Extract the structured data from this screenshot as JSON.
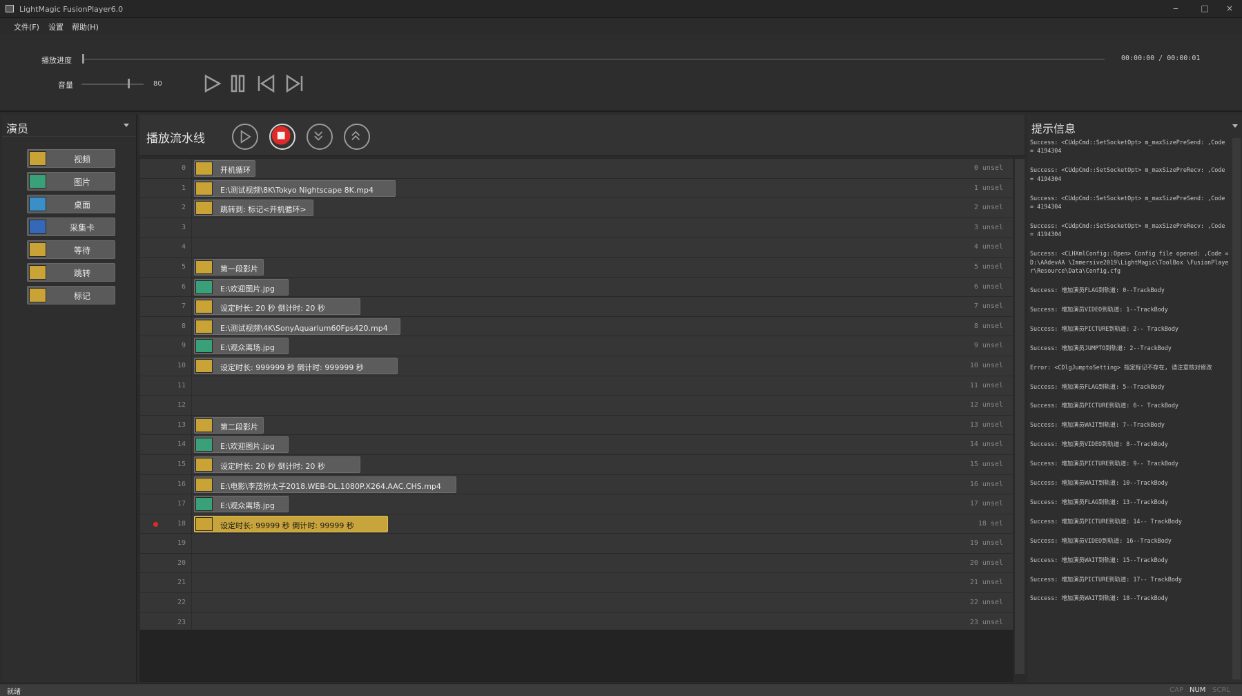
{
  "window": {
    "title": "LightMagic FusionPlayer6.0",
    "controls": [
      "‒",
      "□",
      "×"
    ]
  },
  "menu": [
    "文件(F)",
    "设置",
    "帮助(H)"
  ],
  "transport": {
    "progress_label": "播放进度",
    "time": "00:00:00 / 00:00:01",
    "volume_label": "音量",
    "volume_value": "80",
    "buttons": [
      "play-icon",
      "pause-icon",
      "previous-icon",
      "next-icon"
    ]
  },
  "actors": {
    "title": "演员",
    "items": [
      {
        "label": "视频",
        "icon": "video-icon"
      },
      {
        "label": "图片",
        "icon": "picture-icon"
      },
      {
        "label": "桌面",
        "icon": "desktop-icon"
      },
      {
        "label": "采集卡",
        "icon": "capture-card-icon"
      },
      {
        "label": "等待",
        "icon": "wait-clock-icon"
      },
      {
        "label": "跳转",
        "icon": "jump-icon"
      },
      {
        "label": "标记",
        "icon": "flag-icon"
      }
    ]
  },
  "pipeline": {
    "title": "播放流水线",
    "buttons": [
      "play-icon",
      "stop-icon",
      "collapse-icon",
      "expand-icon"
    ],
    "rows": [
      {
        "num": "0",
        "status": "0 unsel",
        "clip": {
          "type": "flag",
          "text": "开机循环"
        }
      },
      {
        "num": "1",
        "status": "1 unsel",
        "clip": {
          "type": "video",
          "text": "E:\\测试视频\\8K\\Tokyo Nightscape 8K.mp4"
        }
      },
      {
        "num": "2",
        "status": "2 unsel",
        "clip": {
          "type": "jump",
          "text": "跳转到: 标记<开机循环>"
        }
      },
      {
        "num": "3",
        "status": "3 unsel",
        "clip": null
      },
      {
        "num": "4",
        "status": "4 unsel",
        "clip": null
      },
      {
        "num": "5",
        "status": "5 unsel",
        "clip": {
          "type": "flag",
          "text": "第一段影片"
        }
      },
      {
        "num": "6",
        "status": "6 unsel",
        "clip": {
          "type": "picture",
          "text": "E:\\欢迎图片.jpg"
        }
      },
      {
        "num": "7",
        "status": "7 unsel",
        "clip": {
          "type": "wait",
          "text": "设定时长: 20 秒    倒计时: 20 秒"
        }
      },
      {
        "num": "8",
        "status": "8 unsel",
        "clip": {
          "type": "video",
          "text": "E:\\测试视频\\4K\\SonyAquarium60Fps420.mp4"
        }
      },
      {
        "num": "9",
        "status": "9 unsel",
        "clip": {
          "type": "picture",
          "text": "E:\\观众离场.jpg"
        }
      },
      {
        "num": "10",
        "status": "10 unsel",
        "clip": {
          "type": "wait",
          "text": "设定时长: 999999 秒    倒计时: 999999 秒"
        }
      },
      {
        "num": "11",
        "status": "11 unsel",
        "clip": null
      },
      {
        "num": "12",
        "status": "12 unsel",
        "clip": null
      },
      {
        "num": "13",
        "status": "13 unsel",
        "clip": {
          "type": "flag",
          "text": "第二段影片"
        }
      },
      {
        "num": "14",
        "status": "14 unsel",
        "clip": {
          "type": "picture",
          "text": "E:\\欢迎图片.jpg"
        }
      },
      {
        "num": "15",
        "status": "15 unsel",
        "clip": {
          "type": "wait",
          "text": "设定时长: 20 秒    倒计时: 20 秒"
        }
      },
      {
        "num": "16",
        "status": "16 unsel",
        "clip": {
          "type": "video",
          "text": "E:\\电影\\李茂扮太子2018.WEB-DL.1080P.X264.AAC.CHS.mp4"
        }
      },
      {
        "num": "17",
        "status": "17 unsel",
        "clip": {
          "type": "picture",
          "text": "E:\\观众离场.jpg"
        }
      },
      {
        "num": "18",
        "status": "18 sel",
        "active": true,
        "clip": {
          "type": "wait",
          "text": "设定时长: 99999 秒    倒计时: 99999 秒",
          "selected": true
        }
      },
      {
        "num": "19",
        "status": "19 unsel",
        "clip": null
      },
      {
        "num": "20",
        "status": "20 unsel",
        "clip": null
      },
      {
        "num": "21",
        "status": "21 unsel",
        "clip": null
      },
      {
        "num": "22",
        "status": "22 unsel",
        "clip": null
      },
      {
        "num": "23",
        "status": "23 unsel",
        "clip": null
      }
    ]
  },
  "info": {
    "title": "提示信息",
    "log": [
      "Success: <CUdpCmd::SetSocketOpt> m_maxSizePreSend: ,Code = 4194304",
      "Success: <CUdpCmd::SetSocketOpt> m_maxSizePreRecv: ,Code = 4194304",
      "Success: <CUdpCmd::SetSocketOpt> m_maxSizePreSend: ,Code = 4194304",
      "Success: <CUdpCmd::SetSocketOpt> m_maxSizePreRecv: ,Code = 4194304",
      "Success: <CLHXmlConfig::Open> Config file opened: ,Code = D:\\AAdevAA \\Immersive2019\\LightMagic\\ToolBox \\FusionPlayer\\Resource\\Data\\Config.cfg",
      "Success: 增加演员FLAG到轨道: 0--TrackBody",
      "Success: 增加演员VIDEO到轨道: 1--TrackBody",
      "Success: 增加演员PICTURE到轨道: 2-- TrackBody",
      "Success: 增加演员JUMPTO到轨道: 2--TrackBody",
      "Error: <CDlgJumptoSetting> 指定标记不存在, 请注意核对修改",
      "Success: 增加演员FLAG到轨道: 5--TrackBody",
      "Success: 增加演员PICTURE到轨道: 6-- TrackBody",
      "Success: 增加演员WAIT到轨道: 7--TrackBody",
      "Success: 增加演员VIDEO到轨道: 8--TrackBody",
      "Success: 增加演员PICTURE到轨道: 9-- TrackBody",
      "Success: 增加演员WAIT到轨道: 10--TrackBody",
      "Success: 增加演员FLAG到轨道: 13--TrackBody",
      "Success: 增加演员PICTURE到轨道: 14-- TrackBody",
      "Success: 增加演员VIDEO到轨道: 16--TrackBody",
      "Success: 增加演员WAIT到轨道: 15--TrackBody",
      "Success: 增加演员PICTURE到轨道: 17-- TrackBody",
      "Success: 增加演员WAIT到轨道: 18--TrackBody"
    ]
  },
  "statusbar": {
    "text": "就绪",
    "indicators": [
      "CAP",
      "NUM",
      "SCRL"
    ]
  },
  "colors": {
    "accent_selected": "#c8a43c",
    "stop_red": "#e02a2a",
    "active_dot": "#e02a2a"
  }
}
